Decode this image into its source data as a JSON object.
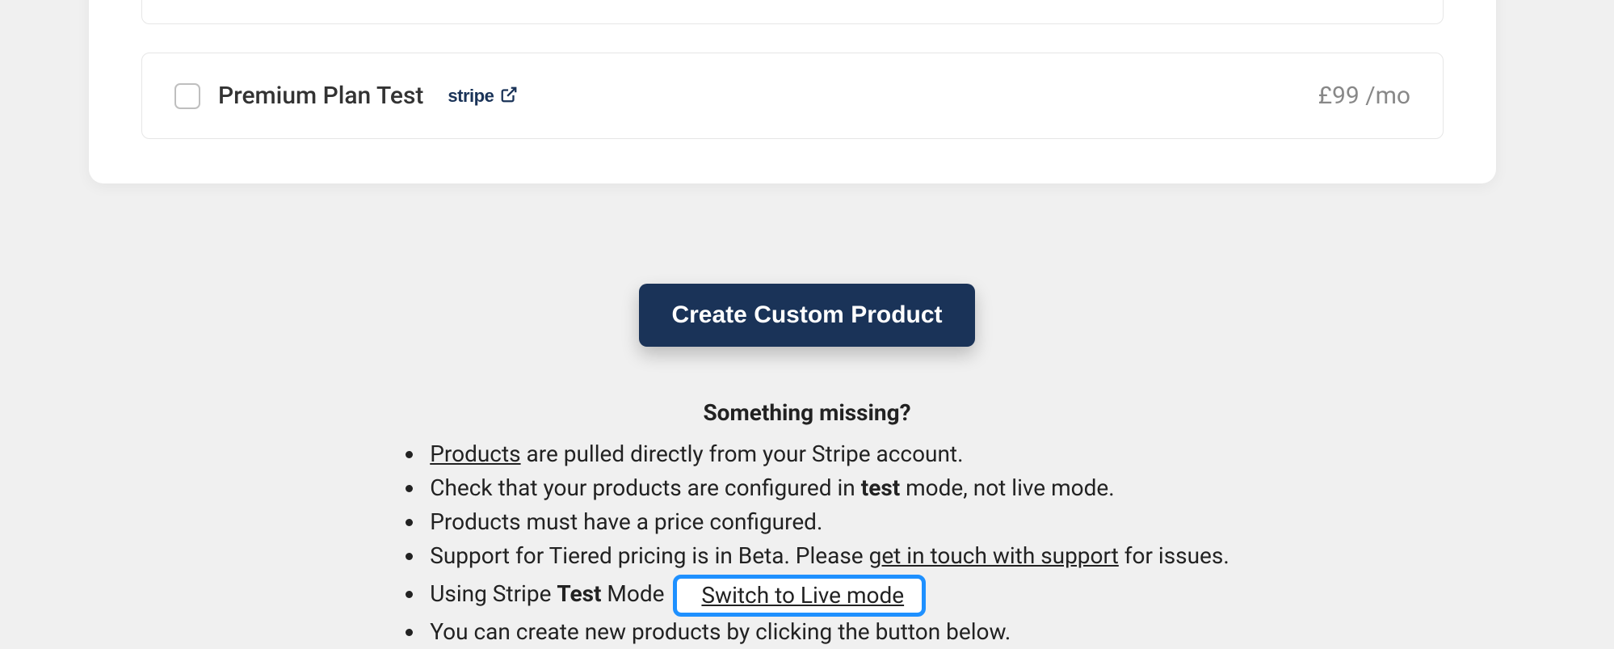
{
  "product": {
    "name": "Premium Plan Test",
    "stripe_label": "stripe",
    "price": "£99 /mo"
  },
  "cta": {
    "create_label": "Create Custom Product"
  },
  "help": {
    "heading": "Something missing?",
    "products_link": "Products",
    "line1_rest": " are pulled directly from your Stripe account.",
    "line2_a": "Check that your products are configured in ",
    "line2_bold": "test",
    "line2_b": " mode, not live mode.",
    "line3": "Products must have a price configured.",
    "line4_a": "Support for Tiered pricing is in Beta. Please ",
    "line4_link": "get in touch with support",
    "line4_b": " for issues.",
    "line5_a": "Using Stripe ",
    "line5_bold": "Test",
    "line5_b": " Mode ",
    "switch_label": "Switch to Live mode",
    "line6": "You can create new products by clicking the button below."
  }
}
